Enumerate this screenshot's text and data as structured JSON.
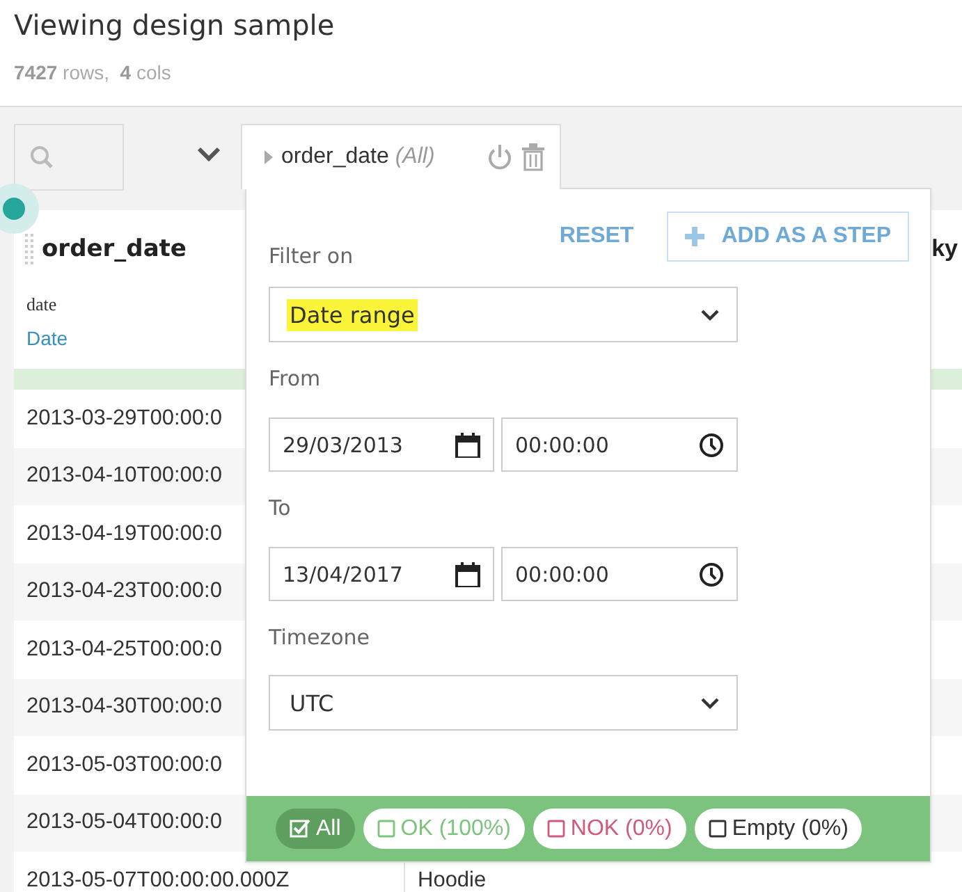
{
  "title": "Viewing design sample",
  "summary": "**7427** rows,  **4** cols",
  "filter_tab": {
    "column": "order_date",
    "state": "(All)"
  },
  "table": {
    "columns": [
      {
        "header": "order_date",
        "type": "date",
        "semantic_type": "Date"
      },
      {
        "header": "ky"
      }
    ],
    "rows": [
      {
        "cells": [
          "2013-03-29T00:00:0"
        ]
      },
      {
        "cells": [
          "2013-04-10T00:00:0"
        ]
      },
      {
        "cells": [
          "2013-04-19T00:00:0"
        ]
      },
      {
        "cells": [
          "2013-04-23T00:00:0"
        ]
      },
      {
        "cells": [
          "2013-04-25T00:00:0"
        ]
      },
      {
        "cells": [
          "2013-04-30T00:00:0"
        ]
      },
      {
        "cells": [
          "2013-05-03T00:00:0"
        ]
      },
      {
        "cells": [
          "2013-05-04T00:00:0"
        ]
      },
      {
        "cells": [
          "2013-05-07T00:00:00.000Z",
          "Hoodie"
        ]
      }
    ]
  },
  "filter_popup": {
    "reset": {
      "label": "RESET",
      "disabled": true
    },
    "add_step": {
      "label": "ADD AS A STEP",
      "disabled": true
    },
    "filter_on": {
      "label": "Filter on",
      "value": "Date range",
      "highlighted": true
    },
    "from": {
      "label": "From",
      "date": "29/03/2013",
      "time": "00:00:00"
    },
    "to": {
      "label": "To",
      "date": "13/04/2017",
      "time": "00:00:00"
    },
    "timezone": {
      "label": "Timezone",
      "value": "UTC"
    },
    "chips": [
      {
        "label": "All",
        "kind": "all",
        "checked": true
      },
      {
        "label": "OK (100%)",
        "kind": "ok",
        "checked": false
      },
      {
        "label": "NOK (0%)",
        "kind": "nok",
        "checked": false
      },
      {
        "label": "Empty (0%)",
        "kind": "empty",
        "checked": false
      }
    ]
  }
}
